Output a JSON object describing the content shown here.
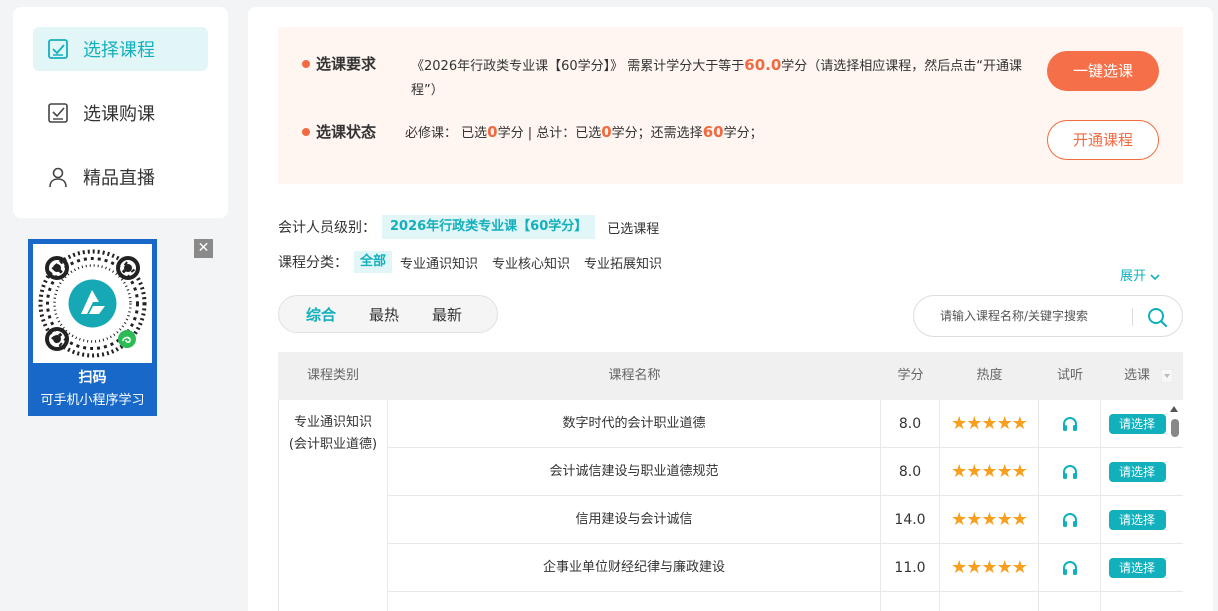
{
  "sidebar": {
    "items": [
      {
        "label": "选择课程",
        "icon": "checkbox-icon",
        "active": true
      },
      {
        "label": "选课购课",
        "icon": "checkbox-icon",
        "active": false
      },
      {
        "label": "精品直播",
        "icon": "user-icon",
        "active": false
      }
    ]
  },
  "qr": {
    "line1": "扫码",
    "line2": "可手机小程序学习",
    "close": "✕"
  },
  "requirement": {
    "label": "选课要求",
    "text_before": "《2026年行政类专业课【60学分】》 需累计学分大于等于",
    "credits": "60.0",
    "text_after": "学分（请选择相应课程，然后点击“开通课程”）"
  },
  "status": {
    "label": "选课状态",
    "p1": "必修课：  已选",
    "required_selected": "0",
    "p2": "学分 | 总计：已选",
    "total_selected": "0",
    "p3": "学分；还需选择",
    "remaining": "60",
    "p4": "学分；"
  },
  "buttons": {
    "one_click": "一键选课",
    "open_course": "开通课程"
  },
  "filters": {
    "level_label": "会计人员级别：",
    "level_value": "2026年行政类专业课【60学分】",
    "selected_link": "已选课程",
    "category_label": "课程分类：",
    "categories": [
      "全部",
      "专业通识知识",
      "专业核心知识",
      "专业拓展知识"
    ],
    "expand": "展开"
  },
  "sort_tabs": [
    "综合",
    "最热",
    "最新"
  ],
  "search": {
    "placeholder": "请输入课程名称/关键字搜索"
  },
  "table": {
    "headers": [
      "课程类别",
      "课程名称",
      "学分",
      "热度",
      "试听",
      "选课"
    ],
    "category_line1": "专业通识知识",
    "category_line2": "(会计职业道德)",
    "stars": "★★★★★",
    "pick_label": "请选择",
    "rows": [
      {
        "name": "数字时代的会计职业道德",
        "credit": "8.0",
        "rating": 5
      },
      {
        "name": "会计诚信建设与职业道德规范",
        "credit": "8.0",
        "rating": 5
      },
      {
        "name": "信用建设与会计诚信",
        "credit": "14.0",
        "rating": 5
      },
      {
        "name": "企事业单位财经纪律与廉政建设",
        "credit": "11.0",
        "rating": 5
      }
    ]
  },
  "colors": {
    "accent": "#12b0bd",
    "orange": "#f26a3f",
    "star": "#f8a01d",
    "qr_card": "#1768c9"
  }
}
